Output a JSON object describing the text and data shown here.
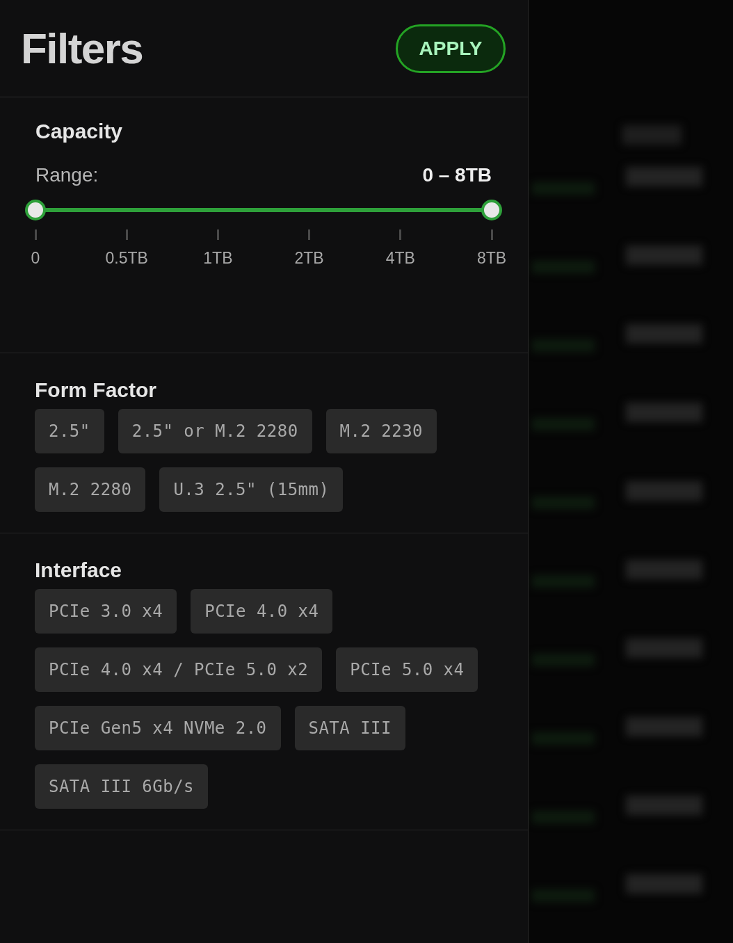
{
  "header": {
    "title": "Filters",
    "apply_button": "APPLY"
  },
  "capacity": {
    "title": "Capacity",
    "range_label": "Range:",
    "range_value": "0 – 8TB",
    "thumbs": [
      {
        "level": 0
      },
      {
        "level": 1
      }
    ],
    "ticks": [
      "0",
      "0.5TB",
      "1TB",
      "2TB",
      "4TB",
      "8TB"
    ]
  },
  "filter_groups": [
    {
      "title": "Form Factor",
      "options": [
        {
          "label": "2.5\"",
          "selected": false
        },
        {
          "label": "2.5\" or M.2 2280",
          "selected": false
        },
        {
          "label": "M.2 2230",
          "selected": false
        },
        {
          "label": "M.2 2280",
          "selected": false
        },
        {
          "label": "U.3 2.5\" (15mm)",
          "selected": false
        }
      ]
    },
    {
      "title": "Interface",
      "options": [
        {
          "label": "PCIe 3.0 x4",
          "selected": false
        },
        {
          "label": "PCIe 4.0 x4",
          "selected": false
        },
        {
          "label": "PCIe 4.0 x4 / PCIe 5.0 x2",
          "selected": false
        },
        {
          "label": "PCIe 5.0 x4",
          "selected": false
        },
        {
          "label": "PCIe Gen5 x4 NVMe 2.0",
          "selected": false
        },
        {
          "label": "SATA III",
          "selected": false
        },
        {
          "label": "SATA III 6Gb/s",
          "selected": false
        }
      ]
    }
  ]
}
